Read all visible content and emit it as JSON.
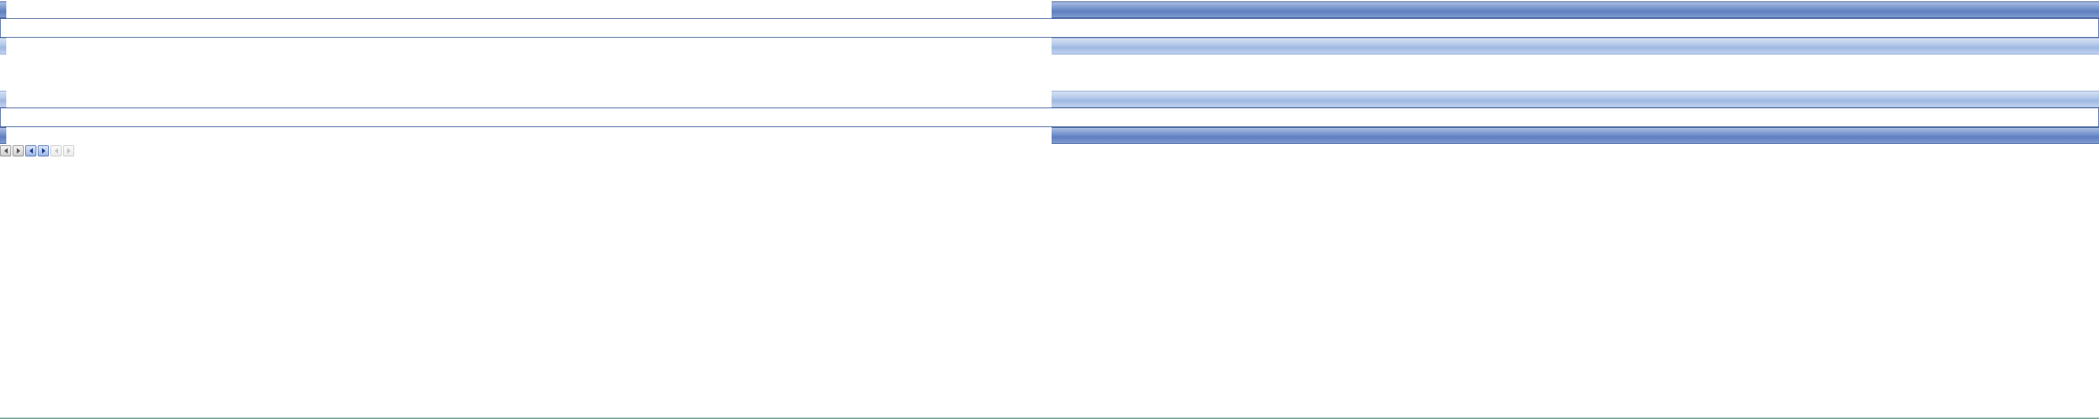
{
  "colors": {
    "bar_dark": "#5f7fc0",
    "bar_light": "#b5c9ea",
    "frame_border": "#3e5b97",
    "button_gray": "#cfcfcf",
    "button_blue": "#9cb6e6",
    "button_disabled": "#ececec",
    "bottom_line": "#7fa8a0"
  },
  "toolbar": {
    "buttons": [
      {
        "icon": "chevron-left-icon",
        "state": "gray"
      },
      {
        "icon": "chevron-right-icon",
        "state": "gray"
      },
      {
        "icon": "chevron-left-icon",
        "state": "blue"
      },
      {
        "icon": "chevron-right-icon",
        "state": "blue"
      },
      {
        "icon": "chevron-left-icon",
        "state": "disabled"
      },
      {
        "icon": "chevron-right-icon",
        "state": "disabled"
      }
    ]
  }
}
